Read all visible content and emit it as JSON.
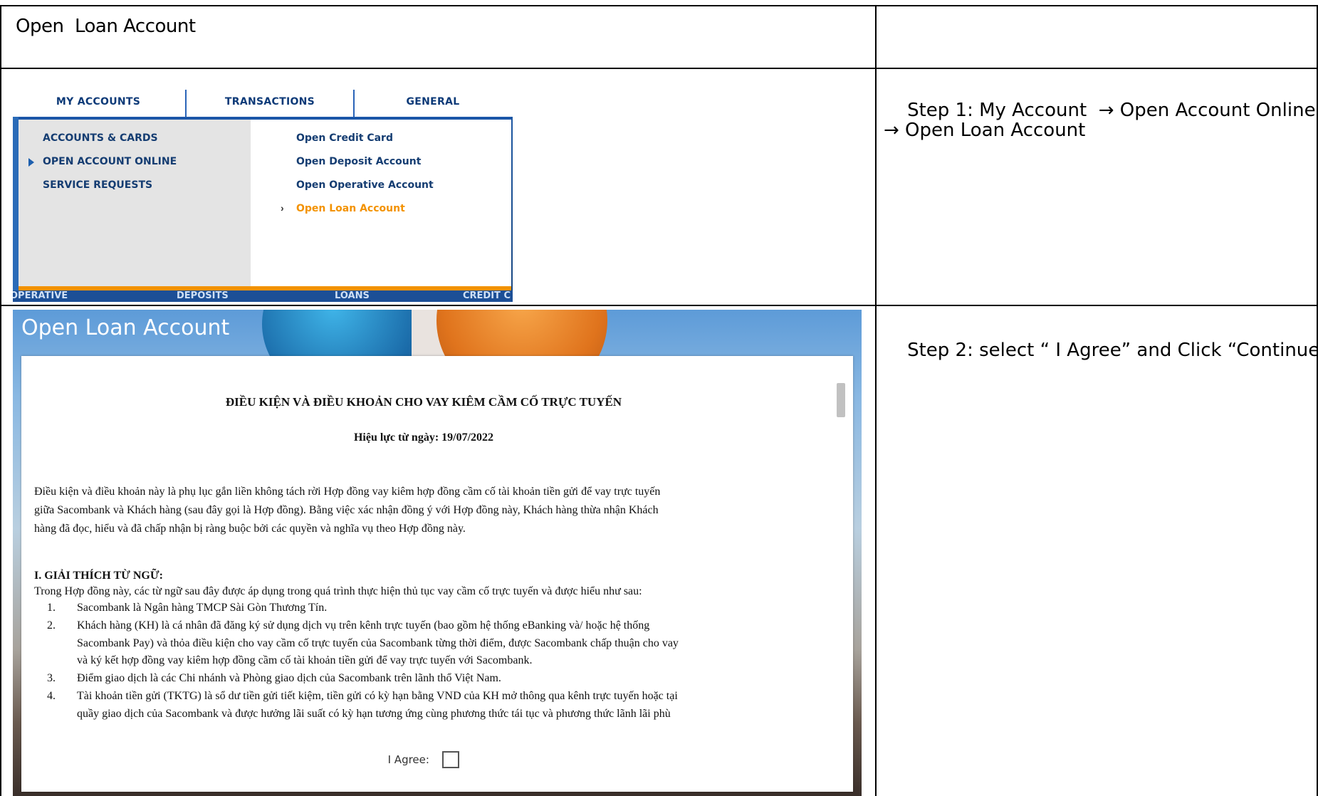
{
  "row1": {
    "title": "Open  Loan Account"
  },
  "step1": {
    "label": "Step 1",
    "text": ": My Account  → Open Account Online",
    "text2": "→ Open Loan Account"
  },
  "step2": {
    "label": "Step 2",
    "text": ": select “ I Agree” and Click “Continue”"
  },
  "menu": {
    "tabs": [
      "MY ACCOUNTS",
      "TRANSACTIONS",
      "GENERAL"
    ],
    "left_items": [
      "ACCOUNTS & CARDS",
      "OPEN ACCOUNT ONLINE",
      "SERVICE REQUESTS"
    ],
    "right_items": [
      "Open Credit Card",
      "Open Deposit Account",
      "Open Operative Account",
      "Open Loan Account"
    ],
    "sub_tabs": [
      "OPERATIVE",
      "DEPOSITS",
      "LOANS",
      "CREDIT C"
    ],
    "colors": {
      "active": "#f39200",
      "nav": "#153d72"
    }
  },
  "loan": {
    "title": "Open Loan Account",
    "heading": "ĐIỀU KIỆN VÀ ĐIỀU KHOẢN CHO VAY KIÊM CẦM CỐ TRỰC TUYẾN",
    "effective": "Hiệu lực từ ngày: 19/07/2022",
    "intro_lines": [
      "Điều kiện và điều khoản này là phụ lục gắn liền không tách rời Hợp đồng vay kiêm hợp đồng cầm cố tài khoản tiền gửi để vay trực tuyến",
      "giữa Sacombank và Khách hàng (sau đây gọi là Hợp đồng). Bằng việc xác nhận đồng ý với Hợp đồng này, Khách hàng thừa nhận Khách",
      "hàng đã đọc, hiểu và đã chấp nhận bị ràng buộc bởi các quyền và nghĩa vụ theo Hợp đồng này."
    ],
    "section1_title": "I. GIẢI THÍCH TỪ NGỮ:",
    "section1_intro": "Trong Hợp đồng này, các từ ngữ sau đây được áp dụng trong quá trình thực hiện thủ tục vay cầm cố trực tuyến và được hiểu như sau:",
    "items": [
      {
        "num": "1.",
        "lines": [
          "Sacombank là Ngân hàng TMCP Sài Gòn Thương Tín."
        ]
      },
      {
        "num": "2.",
        "lines": [
          "Khách hàng (KH) là cá nhân đã đăng ký sử dụng dịch vụ trên kênh trực tuyến (bao gồm hệ thống eBanking và/ hoặc hệ thống",
          "Sacombank Pay) và thỏa điều kiện cho vay cầm cố trực tuyến của Sacombank từng thời điểm, được Sacombank chấp thuận cho vay",
          "và ký kết hợp đồng vay kiêm hợp đồng cầm cố tài khoản tiền gửi để vay trực tuyến với Sacombank."
        ]
      },
      {
        "num": "3.",
        "lines": [
          "Điểm giao dịch là các Chi nhánh và Phòng giao dịch của Sacombank trên lãnh thổ Việt Nam."
        ]
      },
      {
        "num": "4.",
        "lines": [
          "Tài khoản tiền gửi (TKTG) là sổ dư tiền gửi tiết kiệm, tiền gửi có kỳ hạn bằng VND của KH mở thông qua kênh trực tuyến hoặc tại",
          "quầy giao dịch của Sacombank và được hưởng lãi suất có kỳ hạn tương ứng cùng phương thức tái tục và phương thức lãnh lãi phù"
        ]
      }
    ],
    "agree_label": "I Agree:"
  }
}
